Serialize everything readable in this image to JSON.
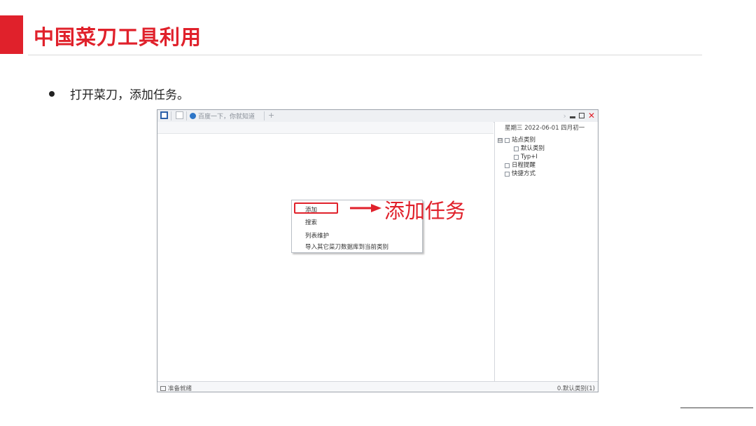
{
  "slide": {
    "title": "中国菜刀工具利用",
    "bullet": "打开菜刀，添加任务。",
    "callout": "添加任务"
  },
  "app": {
    "tab_label": "百度一下，你就知道",
    "tab_plus": "+",
    "window_controls": {
      "chevron": "›",
      "close": "✕"
    },
    "date_line": "星期三  2022-06-01  四月初一",
    "tree": [
      {
        "label": "站点类别",
        "icon": "database-icon",
        "expand": "⊟"
      },
      {
        "label": "默认类别",
        "icon": "folder-icon"
      },
      {
        "label": "Typ+I",
        "icon": "folder-icon"
      },
      {
        "label": "日程提醒",
        "icon": "calendar-icon"
      },
      {
        "label": "快捷方式",
        "icon": "shortcut-icon"
      }
    ],
    "context_menu": [
      "添加",
      "搜索",
      "列表维护",
      "导入其它菜刀数据库到当前类别"
    ],
    "status_left": "准备就绪",
    "status_right": "0.默认类别(1)"
  },
  "colors": {
    "accent": "#e0212b",
    "title_rule": "#d9d9d9",
    "toolbar_bg": "#eef0f3"
  }
}
